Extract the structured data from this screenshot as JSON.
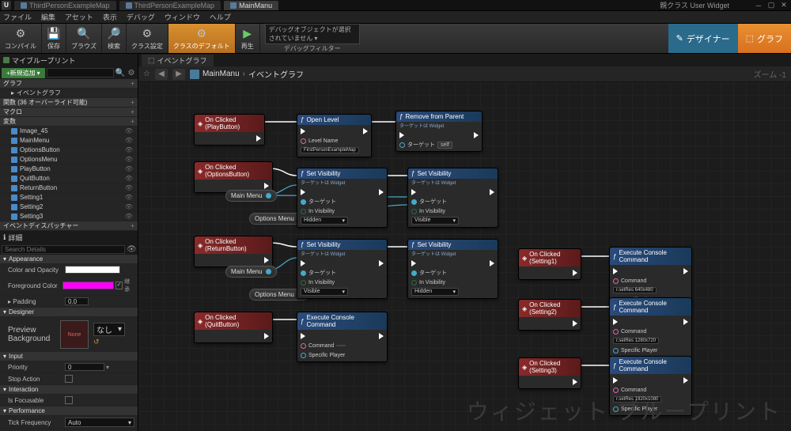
{
  "titlebar": {
    "tabs": [
      {
        "label": "ThirdPersonExampleMap",
        "active": false
      },
      {
        "label": "ThirdPersonExampleMap",
        "active": false
      },
      {
        "label": "MainManu",
        "active": true
      }
    ],
    "parentClass": "親クラス User Widget"
  },
  "menu": {
    "items": [
      "ファイル",
      "編集",
      "アセット",
      "表示",
      "デバッグ",
      "ウィンドウ",
      "ヘルプ"
    ]
  },
  "toolbar": {
    "compile": "コンパイル",
    "save": "保存",
    "browse": "ブラウズ",
    "search": "検索",
    "classSettings": "クラス設定",
    "classDefaults": "クラスのデフォルト",
    "play": "再生",
    "debugFilterPlaceholder": "デバッグオブジェクトが選択されていません ▾",
    "debugFilterLabel": "デバッグフィルター",
    "designer": "デザイナー",
    "graph": "グラフ"
  },
  "myBlueprint": {
    "title": "マイブループリント",
    "addNew": "+新規追加",
    "categories": {
      "graphs": "グラフ",
      "eventGraph": "イベントグラフ",
      "functions": "関数 (36 オーバーライド可能)",
      "macros": "マクロ",
      "variables": "変数",
      "dispatchers": "イベントディスパッチャー"
    },
    "vars": [
      "Image_45",
      "MainMenu",
      "OptionsButton",
      "OptionsMenu",
      "PlayButton",
      "QuitButton",
      "ReturnButton",
      "Setting1",
      "Setting2",
      "Setting3"
    ]
  },
  "details": {
    "title": "詳細",
    "searchPlaceholder": "Search Details",
    "appearance": "Appearance",
    "colorOpacity": "Color and Opacity",
    "foregroundColor": "Foreground Color",
    "padding": "Padding",
    "paddingVal": "0.0",
    "inherit": "継承",
    "designer": "Designer",
    "previewBackground": "Preview Background",
    "previewNone": "None",
    "previewNoneJP": "なし",
    "input": "Input",
    "priority": "Priority",
    "priorityVal": "0",
    "stopAction": "Stop Action",
    "interaction": "Interaction",
    "isFocusable": "Is Focusable",
    "performance": "Performance",
    "tickFrequency": "Tick Frequency",
    "tickFrequencyVal": "Auto"
  },
  "graphTab": "イベントグラフ",
  "breadcrumb": {
    "widget": "MainManu",
    "graph": "イベントグラフ"
  },
  "zoomLabel": "ズーム -1",
  "watermark": "ウィジェット ブループリント",
  "nodes": {
    "onClickedPlay": "On Clicked (PlayButton)",
    "onClickedOptions": "On Clicked (OptionsButton)",
    "onClickedReturn": "On Clicked (ReturnButton)",
    "onClickedQuit": "On Clicked (QuitButton)",
    "onClickedSetting1": "On Clicked (Setting1)",
    "onClickedSetting2": "On Clicked (Setting2)",
    "onClickedSetting3": "On Clicked (Setting3)",
    "openLevel": "Open Level",
    "removeFromParent": "Remove from Parent",
    "setVisibility": "Set Visibility",
    "executeConsole": "Execute Console Command",
    "targetWidget": "ターゲットは Widget",
    "levelName": "Level Name",
    "levelNameVal": "FirstPersonExampleMap",
    "target": "ターゲット",
    "self": "self",
    "inVisibility": "In Visibility",
    "hidden": "Hidden",
    "visible": "Visible",
    "command": "Command",
    "specificPlayer": "Specific Player",
    "cmd1": "r.setRes 640x480",
    "cmd2": "r.setRes 1280x720",
    "cmd3": "r.setRes 1920x1080",
    "mainMenuVar": "Main Menu",
    "optionsMenuVar": "Options Menu"
  }
}
